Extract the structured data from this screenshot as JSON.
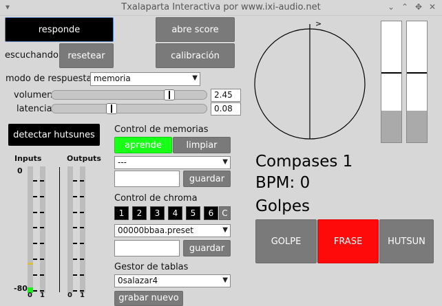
{
  "window": {
    "title": "Txalaparta Interactiva por www.ixi-audio.net",
    "menu_icon": "chevron-down-icon",
    "controls": [
      "chevron-down-icon",
      "chevron-up-icon",
      "move-icon",
      "close-icon"
    ]
  },
  "buttons": {
    "responde": "responde",
    "abre_score": "abre score",
    "escuchando": "escuchando..",
    "resetear": "resetear",
    "calibracion": "calibración",
    "detectar": "detectar hutsunes",
    "aprende": "aprende",
    "limpiar": "limpiar",
    "guardar1": "guardar",
    "guardar2": "guardar",
    "golpe": "GOLPE",
    "frase": "FRASE",
    "hutsun": "HUTSUN",
    "grabar": "grabar nuevo"
  },
  "modo": {
    "label": "modo de respuesta",
    "value": "memoria"
  },
  "volumen": {
    "label": "volumen",
    "value": "2.45",
    "level": 0.78
  },
  "latencia": {
    "label": "latencia",
    "value": "0.08",
    "level": 0.38
  },
  "meters": {
    "inputs": "Inputs",
    "outputs": "Outputs",
    "top": "0",
    "bottom": "-80",
    "ch0": "0",
    "ch1": "1",
    "ch2": "0",
    "ch3": "1"
  },
  "memorias": {
    "label": "Control de memorias",
    "select": "---"
  },
  "chroma": {
    "label": "Control de chroma",
    "numbers": [
      "1",
      "2",
      "3",
      "4",
      "5",
      "6"
    ],
    "c": "C",
    "preset": "00000bbaa.preset"
  },
  "tablas": {
    "label": "Gestor de tablas",
    "select": "0salazar4"
  },
  "status": {
    "compases_label": "Compases",
    "compases": "1",
    "bpm_label": "BPM:",
    "bpm": "0",
    "golpes": "Golpes"
  },
  "circle": {
    "marker": ">"
  },
  "faders": [
    {
      "level": 0.26,
      "handle": 0.58
    },
    {
      "level": 0.26,
      "handle": 0.58
    }
  ]
}
